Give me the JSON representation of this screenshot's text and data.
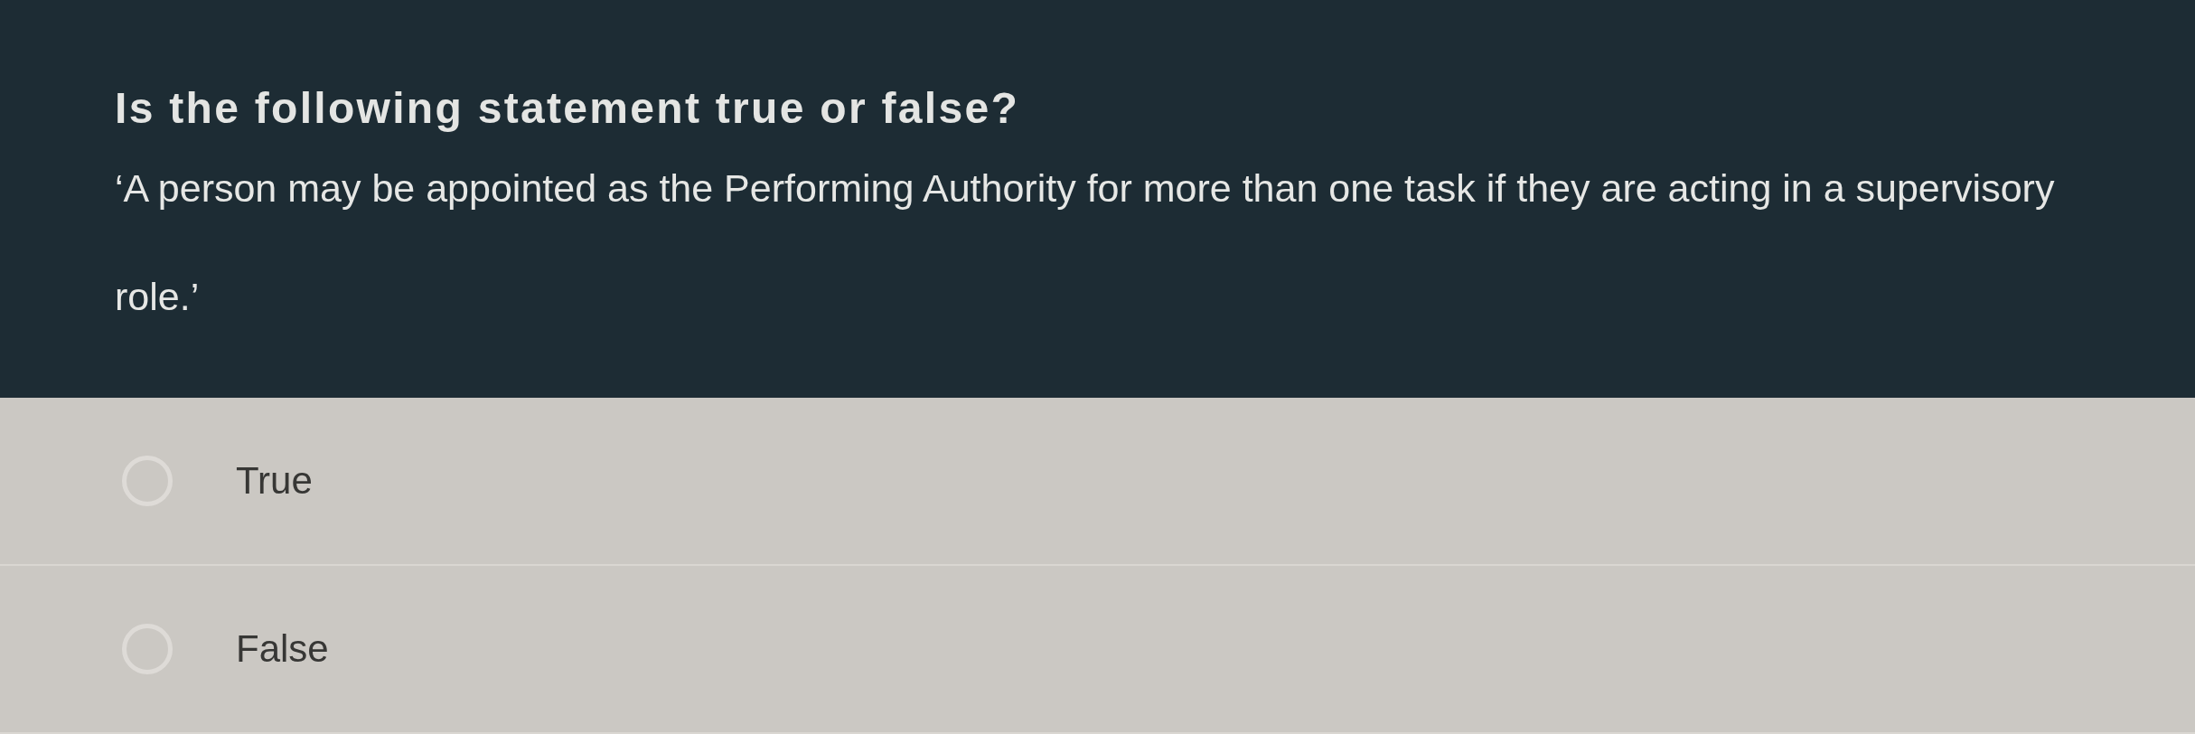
{
  "question": {
    "title": "Is the following statement true or false?",
    "statement": "‘A person may be appointed as the Performing Authority for more than one task if they are acting in a supervisory role.’"
  },
  "options": [
    {
      "label": "True",
      "selected": false
    },
    {
      "label": "False",
      "selected": false
    }
  ]
}
